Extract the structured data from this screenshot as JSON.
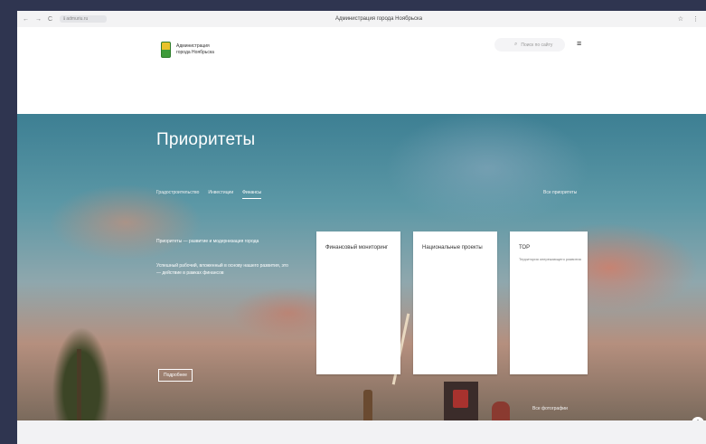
{
  "browser": {
    "nav_icons": [
      "←",
      "→",
      "C"
    ],
    "url": "ℹ admuriu.ru",
    "tab_title": "Администрация города Ноябрьска",
    "right_icons": [
      "☆",
      "⋮"
    ]
  },
  "header": {
    "logo_line1": "Администрация",
    "logo_line2": "города Ноябрьска",
    "search_placeholder": "Поиск по сайту",
    "search_icon": "⌕",
    "menu_icon": "≡"
  },
  "hero": {
    "title": "Приоритеты",
    "tabs": [
      {
        "label": "Градостроительство",
        "active": false
      },
      {
        "label": "Инвестиции",
        "active": false
      },
      {
        "label": "Финансы",
        "active": true
      }
    ],
    "all_link": "Все приоритеты",
    "intro": "Приоритеты — развитие и модернизация города",
    "description": "Успешный рабочий, вложенный в основу нашего развития, это — действие в рамках финансов",
    "more_button": "Подробнее",
    "gallery_link": "Все фотографии",
    "scroll_icon": "⌃"
  },
  "cards": [
    {
      "title": "Финансовый мониторинг",
      "subtitle": ""
    },
    {
      "title": "Национальные проекты",
      "subtitle": ""
    },
    {
      "title": "ТОР",
      "subtitle": "Территория опережающего развития"
    }
  ],
  "colors": {
    "page_background": "#2f3550",
    "hero_sky": "#4a8aa0",
    "hero_sunset": "#dc785f",
    "logo_yellow": "#e9c22b",
    "logo_green": "#3e9b3a"
  }
}
